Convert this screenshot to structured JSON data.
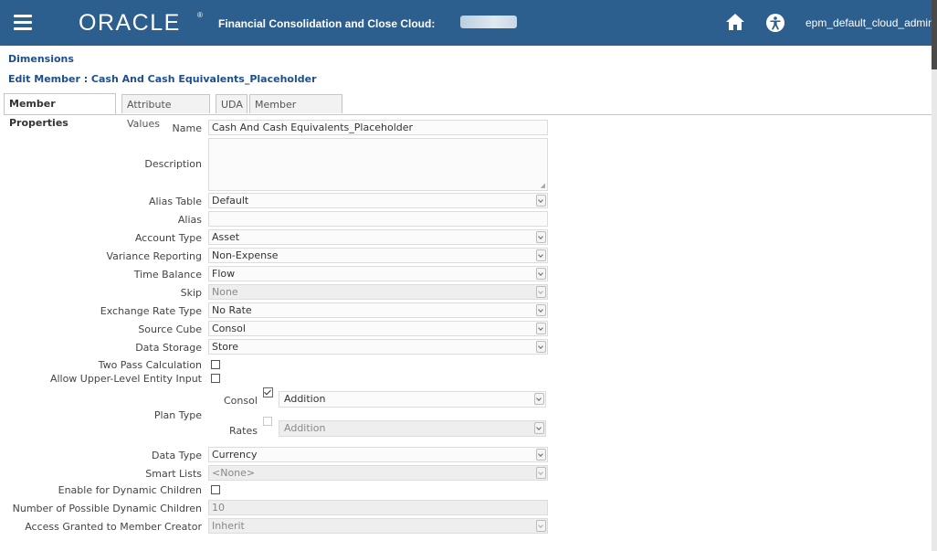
{
  "header": {
    "logo": "ORACLE",
    "logo_mark": "®",
    "app_title": "Financial Consolidation and Close Cloud:",
    "user": "epm_default_cloud_admin"
  },
  "breadcrumb": "Dimensions",
  "page_title": "Edit Member : Cash And Cash Equivalents_Placeholder",
  "tabs": [
    {
      "label": "Member Properties",
      "active": true
    },
    {
      "label": "Attribute Values",
      "active": false
    },
    {
      "label": "UDA",
      "active": false
    },
    {
      "label": "Member Formula",
      "active": false
    }
  ],
  "form": {
    "name": {
      "label": "Name",
      "value": "Cash And Cash Equivalents_Placeholder"
    },
    "description": {
      "label": "Description",
      "value": ""
    },
    "alias_table": {
      "label": "Alias Table",
      "value": "Default"
    },
    "alias": {
      "label": "Alias",
      "value": ""
    },
    "account_type": {
      "label": "Account Type",
      "value": "Asset"
    },
    "variance_reporting": {
      "label": "Variance Reporting",
      "value": "Non-Expense"
    },
    "time_balance": {
      "label": "Time Balance",
      "value": "Flow"
    },
    "skip": {
      "label": "Skip",
      "value": "None"
    },
    "exchange_rate_type": {
      "label": "Exchange Rate Type",
      "value": "No Rate"
    },
    "source_cube": {
      "label": "Source Cube",
      "value": "Consol"
    },
    "data_storage": {
      "label": "Data Storage",
      "value": "Store"
    },
    "two_pass": {
      "label": "Two Pass Calculation",
      "checked": false
    },
    "upper_level": {
      "label": "Allow Upper-Level Entity Input",
      "checked": false
    },
    "plan_type": {
      "label": "Plan Type",
      "rows": [
        {
          "cube": "Consol",
          "checked": true,
          "value": "Addition"
        },
        {
          "cube": "Rates",
          "checked": false,
          "value": "Addition"
        }
      ]
    },
    "data_type": {
      "label": "Data Type",
      "value": "Currency"
    },
    "smart_lists": {
      "label": "Smart Lists",
      "value": "<None>"
    },
    "dynamic_children": {
      "label": "Enable for Dynamic Children",
      "checked": false
    },
    "possible_children": {
      "label": "Number of Possible Dynamic Children",
      "value": "10"
    },
    "access_granted": {
      "label": "Access Granted to Member Creator",
      "value": "Inherit"
    }
  }
}
